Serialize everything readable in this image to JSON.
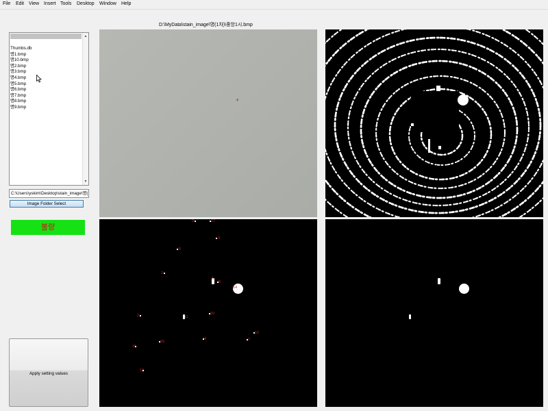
{
  "menubar": {
    "items": [
      "File",
      "Edit",
      "View",
      "Insert",
      "Tools",
      "Desktop",
      "Window",
      "Help"
    ]
  },
  "image_path": "D:\\MyData\\stain_image\\명(1차)\\중앙1시.bmp",
  "file_list": {
    "items": [
      "Thumbs.db",
      "명1.bmp",
      "명10.bmp",
      "명2.bmp",
      "명3.bmp",
      "명4.bmp",
      "명5.bmp",
      "명6.bmp",
      "명7.bmp",
      "명8.bmp",
      "명9.bmp"
    ]
  },
  "folder_path": "C:\\Users\\yskim\\Desktop\\stain_image\\명(1차)",
  "folder_button": "Image Folder Select",
  "status": {
    "label": "불량",
    "color": "#16e114",
    "text_color": "#cc1515"
  },
  "apply_button": "Apply setting values",
  "crosshair": "+",
  "defect_labels": [
    "9",
    "17",
    "3",
    "5",
    "1",
    "6",
    "8",
    "2",
    "14",
    "10",
    "11",
    "12",
    "7",
    "4",
    "16",
    "15",
    "13"
  ],
  "icons": {
    "cursor": "mouse-pointer-icon",
    "scroll_up": "scroll-up-icon",
    "scroll_down": "scroll-down-icon"
  }
}
